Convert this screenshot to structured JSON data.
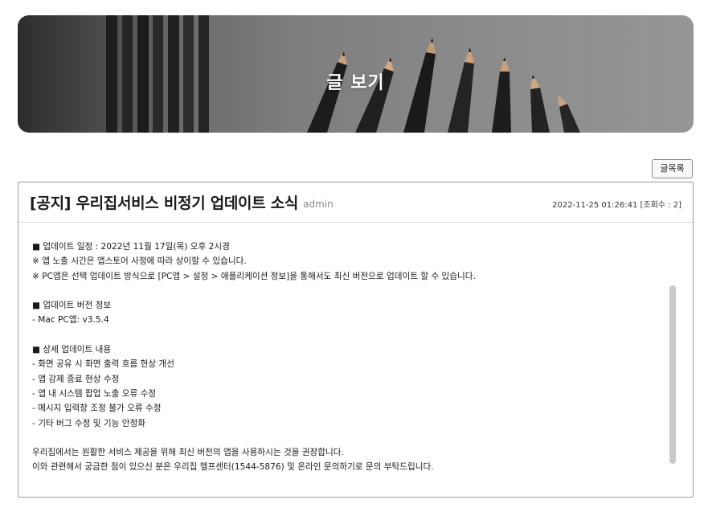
{
  "banner": {
    "title": "글 보기"
  },
  "toolbar": {
    "list_label": "글목록"
  },
  "post": {
    "title": "[공지] 우리집서비스 비정기 업데이트 소식",
    "author": "admin",
    "meta": "2022-11-25 01:26:41 [조회수 : 2]",
    "lines": [
      "■ 업데이트 일정 : 2022년 11월 17일(목) 오후 2시경",
      "※ 앱 노출 시간은 앱스토어 사정에 따라 상이할 수 있습니다.",
      "※ PC앱은 선택 업데이트 방식으로 [PC앱 > 설정 > 애플리케이션 정보]을 통해서도 최신 버전으로 업데이트 할 수 있습니다.",
      "",
      "■ 업데이트 버전 정보",
      "- Mac PC앱: v3.5.4",
      "",
      "■ 상세 업데이트 내용",
      "- 화면 공유 시 화면 출력 흐름 현상 개선",
      "- 앱 강제 종료 현상 수정",
      "- 앱 내 시스템 팝업 노출 오류 수정",
      "- 메시지 입력창 조정 불가 오류 수정",
      "- 기타 버그 수정 및 기능 안정화",
      "",
      "우리집에서는 원활한 서비스 제공을 위해 최신 버전의 앱을 사용하시는 것을 권장합니다.",
      "이와 관련해서 궁금한 점이 있으신 분은 우리집 헬프센터(1544-5876) 및 온라인 문의하기로 문의 부탁드립니다."
    ]
  }
}
